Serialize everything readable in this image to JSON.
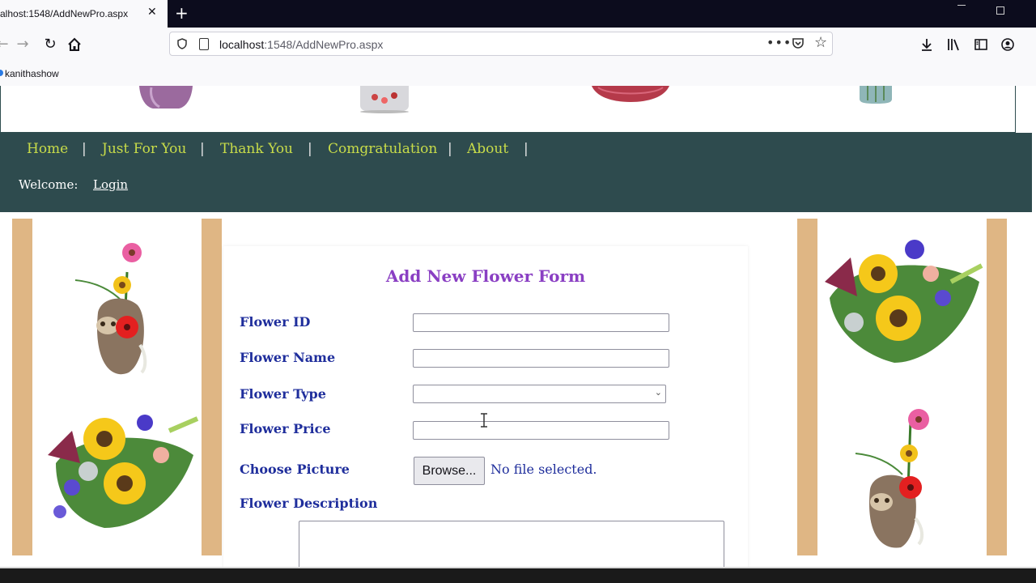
{
  "browser": {
    "tab_title": "alhost:1548/AddNewPro.aspx",
    "tab_close_icon": "close-icon",
    "new_tab_icon": "plus-icon",
    "url_host": "localhost",
    "url_rest": ":1548/AddNewPro.aspx",
    "url_dots": "•••",
    "bookmark_label": "kanithashow"
  },
  "site": {
    "nav": {
      "items": [
        {
          "label": "Home"
        },
        {
          "label": "Just For You"
        },
        {
          "label": "Thank You"
        },
        {
          "label": "Comgratulation"
        },
        {
          "label": "About"
        }
      ],
      "separator": "|",
      "link_color": "#c8dc49",
      "bg_color": "#2e4b4e"
    },
    "welcome_label": "Welcome:",
    "login_label": "Login"
  },
  "form": {
    "title": "Add New Flower Form",
    "title_color": "#8a3fc3",
    "label_color": "#1f2e9c",
    "fields": {
      "flower_id": {
        "label": "Flower ID",
        "value": ""
      },
      "flower_name": {
        "label": "Flower Name",
        "value": ""
      },
      "flower_type": {
        "label": "Flower Type",
        "selected": ""
      },
      "flower_price": {
        "label": "Flower Price",
        "value": ""
      },
      "choose_picture": {
        "label": "Choose Picture",
        "button": "Browse...",
        "status": "No file selected."
      },
      "flower_description": {
        "label": "Flower Description",
        "value": ""
      }
    }
  },
  "colors": {
    "stripe": "#dfb684"
  }
}
